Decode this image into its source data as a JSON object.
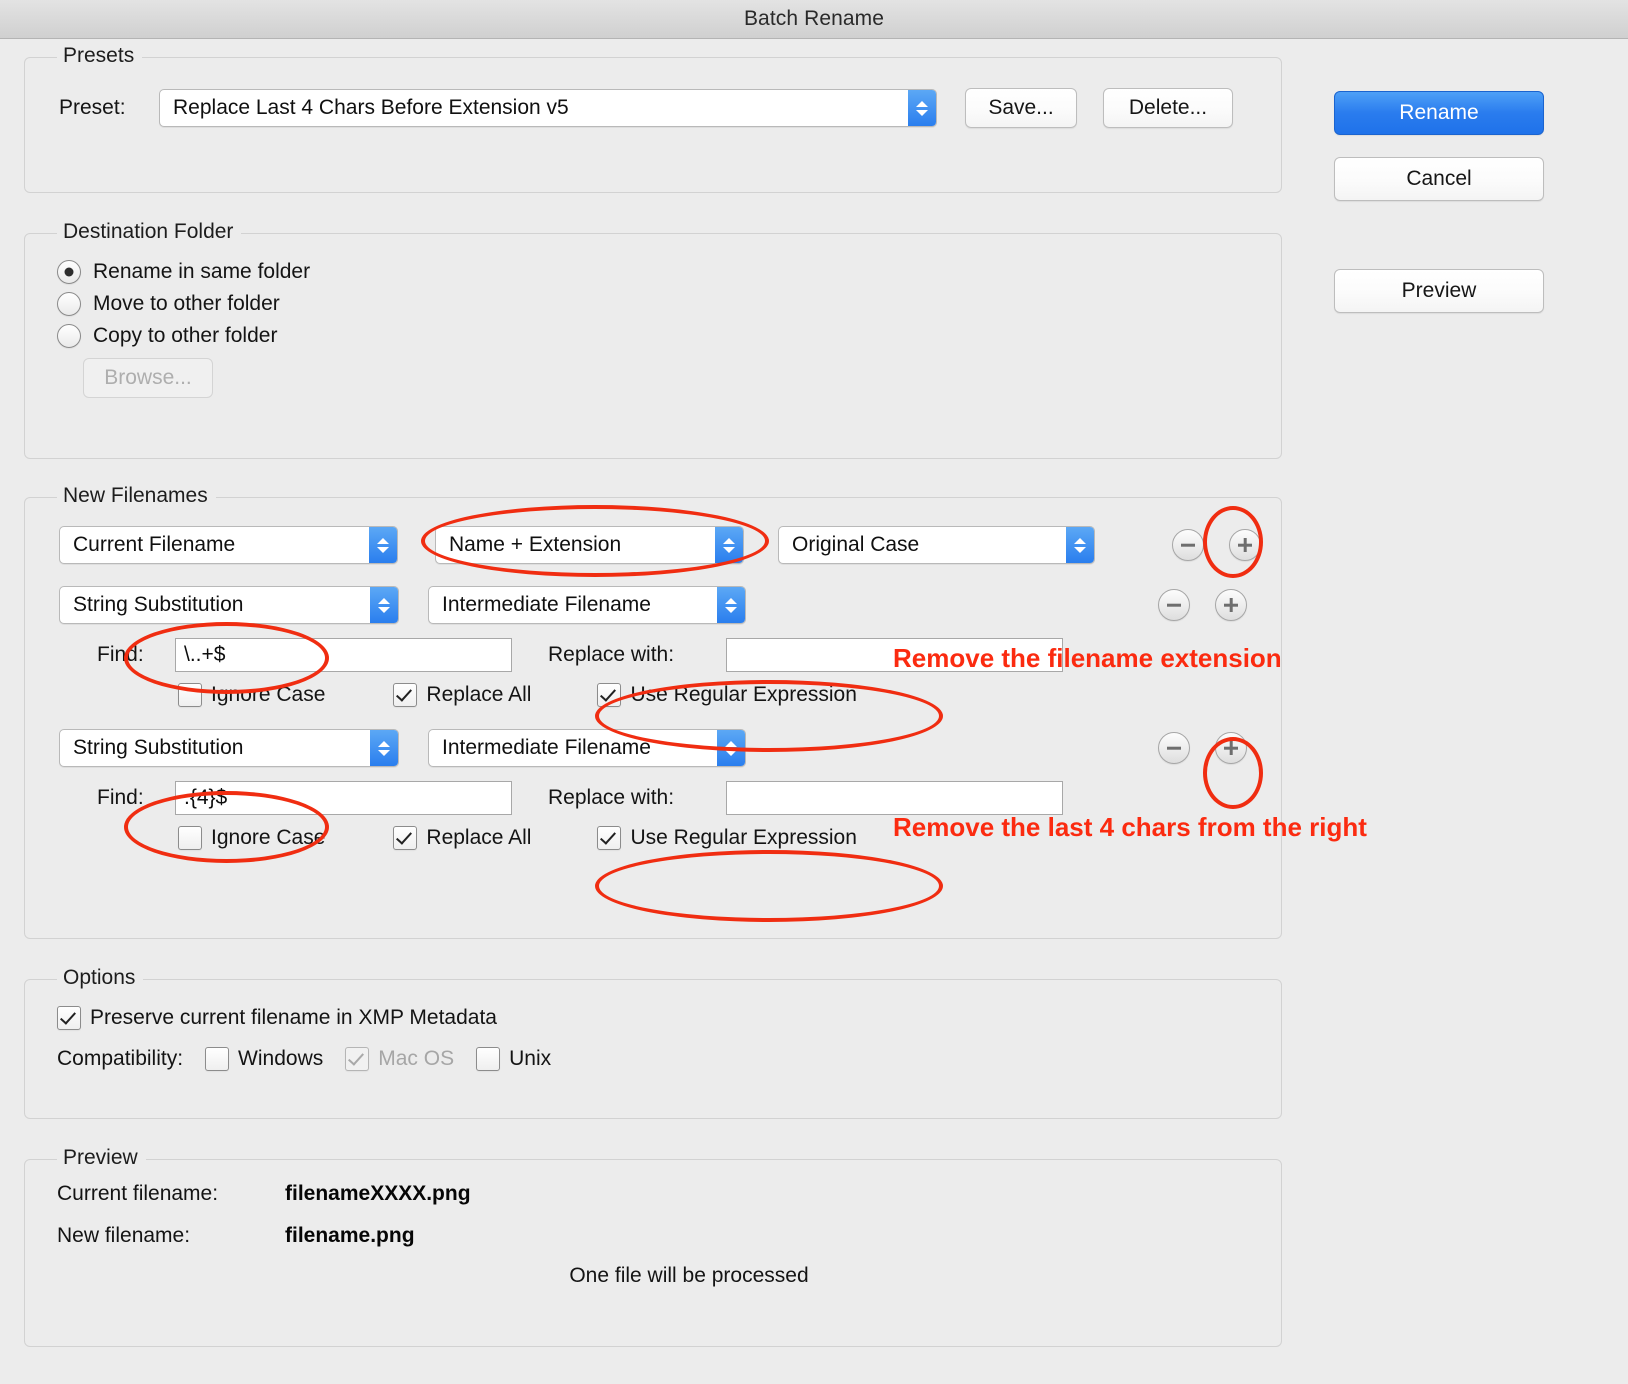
{
  "window": {
    "title": "Batch Rename"
  },
  "presets": {
    "legend": "Presets",
    "preset_label": "Preset:",
    "preset_value": "Replace Last 4 Chars Before Extension v5",
    "save_label": "Save...",
    "delete_label": "Delete..."
  },
  "actions": {
    "rename_label": "Rename",
    "cancel_label": "Cancel",
    "preview_label": "Preview"
  },
  "destination": {
    "legend": "Destination Folder",
    "options": [
      {
        "label": "Rename in same folder",
        "selected": true
      },
      {
        "label": "Move to other folder",
        "selected": false
      },
      {
        "label": "Copy to other folder",
        "selected": false
      }
    ],
    "browse_label": "Browse..."
  },
  "new_filenames": {
    "legend": "New Filenames",
    "row1": {
      "source": "Current Filename",
      "part": "Name + Extension",
      "case": "Original Case"
    },
    "row2": {
      "action": "String Substitution",
      "target": "Intermediate Filename",
      "find_label": "Find:",
      "find_value": "\\..+$",
      "replace_label": "Replace with:",
      "replace_value": "",
      "ignore_case_label": "Ignore Case",
      "ignore_case_checked": false,
      "replace_all_label": "Replace All",
      "replace_all_checked": true,
      "use_regex_label": "Use Regular Expression",
      "use_regex_checked": true
    },
    "row3": {
      "action": "String Substitution",
      "target": "Intermediate Filename",
      "find_label": "Find:",
      "find_value": ".{4}$",
      "replace_label": "Replace with:",
      "replace_value": "",
      "ignore_case_label": "Ignore Case",
      "ignore_case_checked": false,
      "replace_all_label": "Replace All",
      "replace_all_checked": true,
      "use_regex_label": "Use Regular Expression",
      "use_regex_checked": true
    }
  },
  "options": {
    "legend": "Options",
    "preserve_label": "Preserve current filename in XMP Metadata",
    "preserve_checked": true,
    "compatibility_label": "Compatibility:",
    "compat": [
      {
        "label": "Windows",
        "checked": false,
        "disabled": false
      },
      {
        "label": "Mac OS",
        "checked": true,
        "disabled": true
      },
      {
        "label": "Unix",
        "checked": false,
        "disabled": false
      }
    ]
  },
  "preview": {
    "legend": "Preview",
    "current_label": "Current filename:",
    "current_value": "filenameXXXX.png",
    "new_label": "New filename:",
    "new_value": "filename.png",
    "status": "One file will be processed"
  },
  "annotations": {
    "note1": "Remove the filename extension",
    "note2": "Remove the last 4 chars from the right",
    "color": "#fb2b10"
  }
}
